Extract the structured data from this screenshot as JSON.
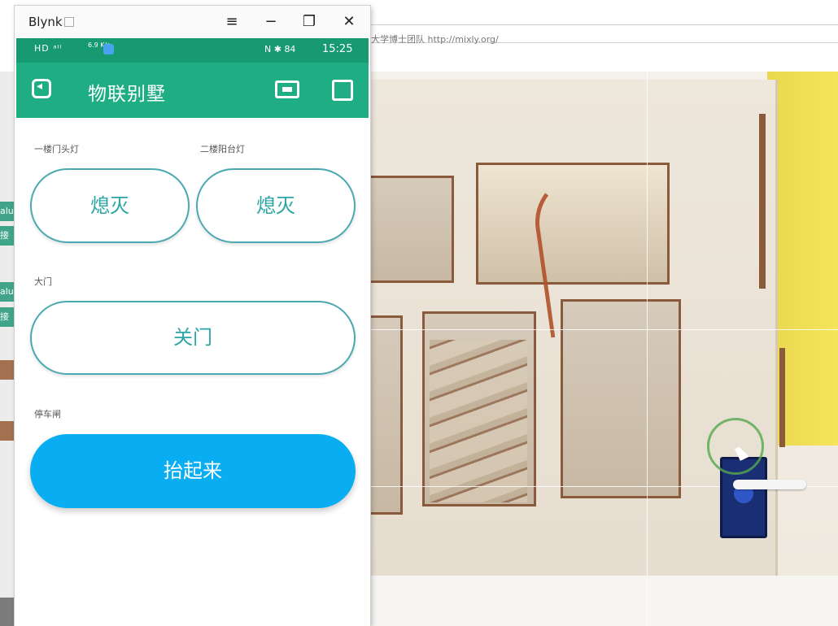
{
  "background": {
    "url_text": "大学博士团队 http://mixly.org/",
    "side_tabs": [
      "alu",
      "接",
      "alu",
      "接"
    ]
  },
  "window": {
    "app_name": "Blynk",
    "menu_icon": "≡",
    "minimize_icon": "−",
    "maximize_icon": "❐",
    "close_icon": "✕"
  },
  "statusbar": {
    "left": "HD ᵃᴵˡ",
    "speed": "6.9\nK/s",
    "right": "N ✱ 84",
    "time": "15:25"
  },
  "appbar": {
    "title": "物联别墅"
  },
  "widgets": {
    "lamp1": {
      "label": "一楼门头灯",
      "state": "熄灭"
    },
    "lamp2": {
      "label": "二楼阳台灯",
      "state": "熄灭"
    },
    "door": {
      "label": "大门",
      "state": "关门"
    },
    "garage": {
      "label": "停车闸",
      "state": "抬起来"
    }
  },
  "colors": {
    "status_bar": "#179a72",
    "app_bar": "#1fae84",
    "outline_button_text": "#2ca6a4",
    "filled_button": "#09aef2"
  }
}
